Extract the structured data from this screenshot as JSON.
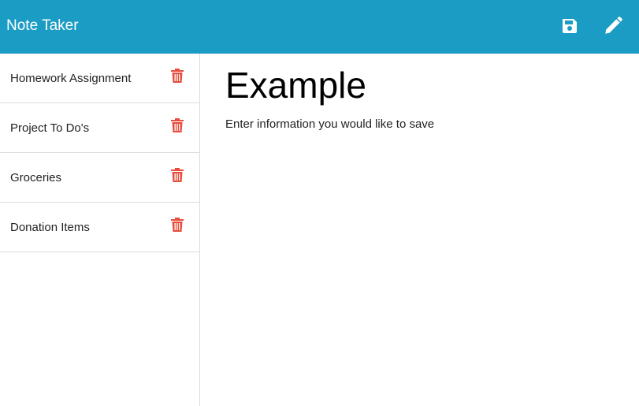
{
  "navbar": {
    "brand": "Note Taker",
    "save_icon": "floppy-disk-icon",
    "edit_icon": "pencil-icon",
    "background": "#1b9cc4"
  },
  "sidebar": {
    "notes": [
      {
        "label": "Homework Assignment",
        "delete_icon": "trash-icon"
      },
      {
        "label": "Project To Do's",
        "delete_icon": "trash-icon"
      },
      {
        "label": "Groceries",
        "delete_icon": "trash-icon"
      },
      {
        "label": "Donation Items",
        "delete_icon": "trash-icon"
      }
    ],
    "delete_color": "#e74c3c"
  },
  "editor": {
    "title_value": "Example",
    "body_value": "Enter information you would like to save"
  }
}
